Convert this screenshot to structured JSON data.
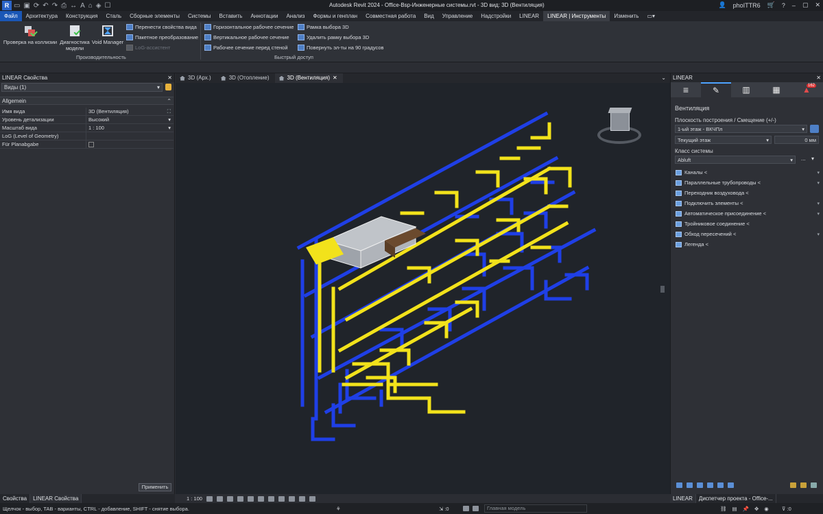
{
  "app": {
    "title": "Autodesk Revit 2024 - Office-Bsp-Инженерные системы.rvt - 3D вид: 3D (Вентиляция)",
    "logo": "R",
    "user": "phoITTR6"
  },
  "menu": [
    {
      "label": "Файл",
      "state": "active"
    },
    {
      "label": "Архитектура"
    },
    {
      "label": "Конструкция"
    },
    {
      "label": "Сталь"
    },
    {
      "label": "Сборные элементы"
    },
    {
      "label": "Системы"
    },
    {
      "label": "Вставить"
    },
    {
      "label": "Аннотации"
    },
    {
      "label": "Анализ"
    },
    {
      "label": "Формы и генплан"
    },
    {
      "label": "Совместная работа"
    },
    {
      "label": "Вид"
    },
    {
      "label": "Управление"
    },
    {
      "label": "Надстройки"
    },
    {
      "label": "LINEAR"
    },
    {
      "label": "LINEAR | Инструменты",
      "state": "ctx"
    },
    {
      "label": "Изменить"
    }
  ],
  "ribbon": {
    "big_buttons": [
      "Проверка на коллизии",
      "Диагностика модели",
      "Void Manager"
    ],
    "small_left": [
      "Перенести свойства вида",
      "Пакетное преобразование",
      "LoG-ассистент"
    ],
    "small_mid": [
      "Горизонтальное рабочее сечение",
      "Вертикальное рабочее сечение",
      "Рабочее сечение перед стеной"
    ],
    "small_right": [
      "Рамка выбора 3D",
      "Удалить рамку выбора 3D",
      "Повернуть эл-ты на 90 градусов"
    ],
    "group1": "Производительность",
    "group2": "Быстрый доступ"
  },
  "left_panel": {
    "title": "LINEAR Свойства",
    "type_selector": "Виды (1)",
    "section": "Allgemein",
    "props": [
      {
        "key": "Имя вида",
        "value": "3D (Вентиляция)"
      },
      {
        "key": "Уровень детализации",
        "value": "Высокий"
      },
      {
        "key": "Масштаб вида",
        "value": "1 : 100"
      },
      {
        "key": "LoG (Level of Geometry)",
        "value": ""
      },
      {
        "key": "Für Planabgabe",
        "value": ""
      }
    ],
    "apply": "Применить",
    "tabs": [
      "Свойства",
      "LINEAR Свойства"
    ]
  },
  "doc_tabs": [
    "3D (Арх.)",
    "3D (Отопление)",
    "3D (Вентиляция)"
  ],
  "view_bar": {
    "scale": "1 : 100"
  },
  "right_panel": {
    "title": "LINEAR",
    "badge": "162",
    "heading": "Вентиляция",
    "plane_label": "Плоскость построения / Смещение (+/-)",
    "plane_value": "1-ый этаж - ВКЧПл",
    "level_value": "Текущий этаж",
    "offset_value": "0 мм",
    "system_label": "Класс системы",
    "system_value": "Abluft",
    "functions": [
      {
        "label": "Каналы <",
        "chev": true
      },
      {
        "label": "Параллельные трубопроводы <",
        "chev": true
      },
      {
        "label": "Переходник воздуховода <",
        "chev": false
      },
      {
        "label": "Подключить элементы <",
        "chev": true
      },
      {
        "label": "Автоматическое присоединение <",
        "chev": true
      },
      {
        "label": "Тройниковое соединение <",
        "chev": false
      },
      {
        "label": "Обход пересечений <",
        "chev": true
      },
      {
        "label": "Легенда <",
        "chev": false
      }
    ],
    "tabs": [
      "LINEAR",
      "Диспетчер проекта - Office-..."
    ]
  },
  "status": {
    "text": "Щелчок - выбор, TAB - варианты, CTRL - добавление, SHIFT - снятие выбора.",
    "count1": ":0",
    "model": "Главная модель",
    "filter": ":0"
  },
  "colors": {
    "supply": "#f2e21b",
    "exhaust": "#1f3fe6",
    "accent": "#1a57b6"
  }
}
